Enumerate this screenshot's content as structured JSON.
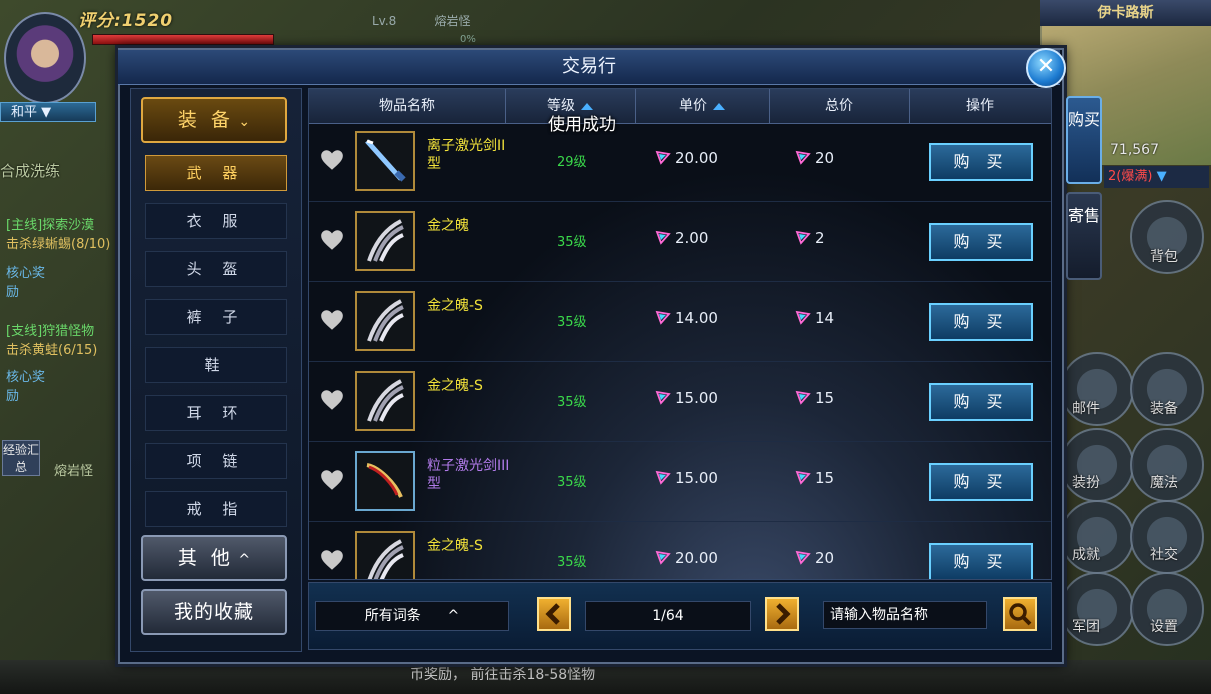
{
  "hud": {
    "score": "评分:1520",
    "peace_label": "和平",
    "target_level": "Lv.8",
    "target_name": "熔岩怪",
    "target_percent": "0%",
    "left_title": "合成洗练",
    "quest_main": "[主线]探索沙漠",
    "quest_main_sub": "击杀绿蜥蜴(8/10)",
    "quest_side": "[支线]狩猎怪物",
    "quest_side_sub": "击杀黄蛙(6/15)",
    "core_reward": "核心奖励",
    "exp_summary": "经验汇总",
    "monster_label": "熔岩怪",
    "minimap_title": "伊卡路斯",
    "minimap_coord": "71,567",
    "minimap_line": "2(爆满)",
    "right_menu": [
      "背包",
      "邮件",
      "装备",
      "装扮",
      "魔法",
      "成就",
      "社交",
      "军团",
      "设置"
    ],
    "bottom_text": "币奖励，  前往击杀18-58怪物"
  },
  "dialog": {
    "title": "交易行",
    "close_icon": "close-icon",
    "side_tabs": [
      "购买",
      "寄售"
    ]
  },
  "sidebar": {
    "top_category": "装 备",
    "sub_items": [
      "武 器",
      "衣 服",
      "头 盔",
      "裤 子",
      "鞋",
      "耳 环",
      "项 链",
      "戒 指"
    ],
    "active_index": 0,
    "other_category": "其 他",
    "favorites": "我的收藏"
  },
  "table": {
    "headers": [
      "物品名称",
      "等级",
      "单价",
      "总价",
      "操作"
    ],
    "toast": "使用成功",
    "rows": [
      {
        "name": "离子激光剑II型",
        "level": "29级",
        "unit_price": "20.00",
        "total": "20",
        "action": "购 买",
        "rarity": "gold",
        "icon": "laser-sword-icon"
      },
      {
        "name": "金之魄",
        "level": "35级",
        "unit_price": "2.00",
        "total": "2",
        "action": "购 买",
        "rarity": "gold",
        "icon": "gold-claw-icon"
      },
      {
        "name": "金之魄-S",
        "level": "35级",
        "unit_price": "14.00",
        "total": "14",
        "action": "购 买",
        "rarity": "gold",
        "icon": "gold-claw-icon"
      },
      {
        "name": "金之魄-S",
        "level": "35级",
        "unit_price": "15.00",
        "total": "15",
        "action": "购 买",
        "rarity": "gold",
        "icon": "gold-claw-icon"
      },
      {
        "name": "粒子激光剑III型",
        "level": "35级",
        "unit_price": "15.00",
        "total": "15",
        "action": "购 买",
        "rarity": "purple",
        "icon": "particle-sword-icon"
      },
      {
        "name": "金之魄-S",
        "level": "35级",
        "unit_price": "20.00",
        "total": "20",
        "action": "购 买",
        "rarity": "gold",
        "icon": "gold-claw-icon"
      }
    ]
  },
  "footer": {
    "filter": "所有词条",
    "page": "1/64",
    "search_placeholder": "请输入物品名称"
  },
  "colors": {
    "gold_text": "#f2e23a",
    "purple_text": "#b07ae8",
    "level_green": "#3ad84a",
    "accent_blue": "#6ad0ff"
  }
}
